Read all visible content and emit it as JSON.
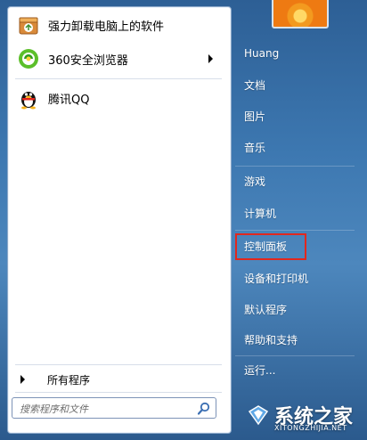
{
  "programs": [
    {
      "label": "强力卸载电脑上的软件",
      "icon": "uninstaller-box-icon",
      "has_submenu": false
    },
    {
      "label": "360安全浏览器",
      "icon": "360-browser-icon",
      "has_submenu": true
    },
    {
      "label": "腾讯QQ",
      "icon": "qq-penguin-icon",
      "has_submenu": false
    }
  ],
  "all_programs": "所有程序",
  "search": {
    "placeholder": "搜索程序和文件"
  },
  "right_items": [
    {
      "label": "Huang",
      "name": "right-item-user"
    },
    {
      "label": "文档",
      "name": "right-item-documents"
    },
    {
      "label": "图片",
      "name": "right-item-pictures"
    },
    {
      "label": "音乐",
      "name": "right-item-music"
    },
    {
      "label": "游戏",
      "name": "right-item-games"
    },
    {
      "label": "计算机",
      "name": "right-item-computer"
    },
    {
      "label": "控制面板",
      "name": "right-item-control-panel"
    },
    {
      "label": "设备和打印机",
      "name": "right-item-devices-printers"
    },
    {
      "label": "默认程序",
      "name": "right-item-default-programs"
    },
    {
      "label": "帮助和支持",
      "name": "right-item-help-support"
    },
    {
      "label": "运行...",
      "name": "right-item-run"
    }
  ],
  "highlighted_item": "控制面板",
  "colors": {
    "highlight_border": "#e2271d",
    "menu_blue": "#3d78b1"
  },
  "watermark": {
    "brand": "系统之家",
    "url": "XITONGZHIJIA.NET"
  }
}
